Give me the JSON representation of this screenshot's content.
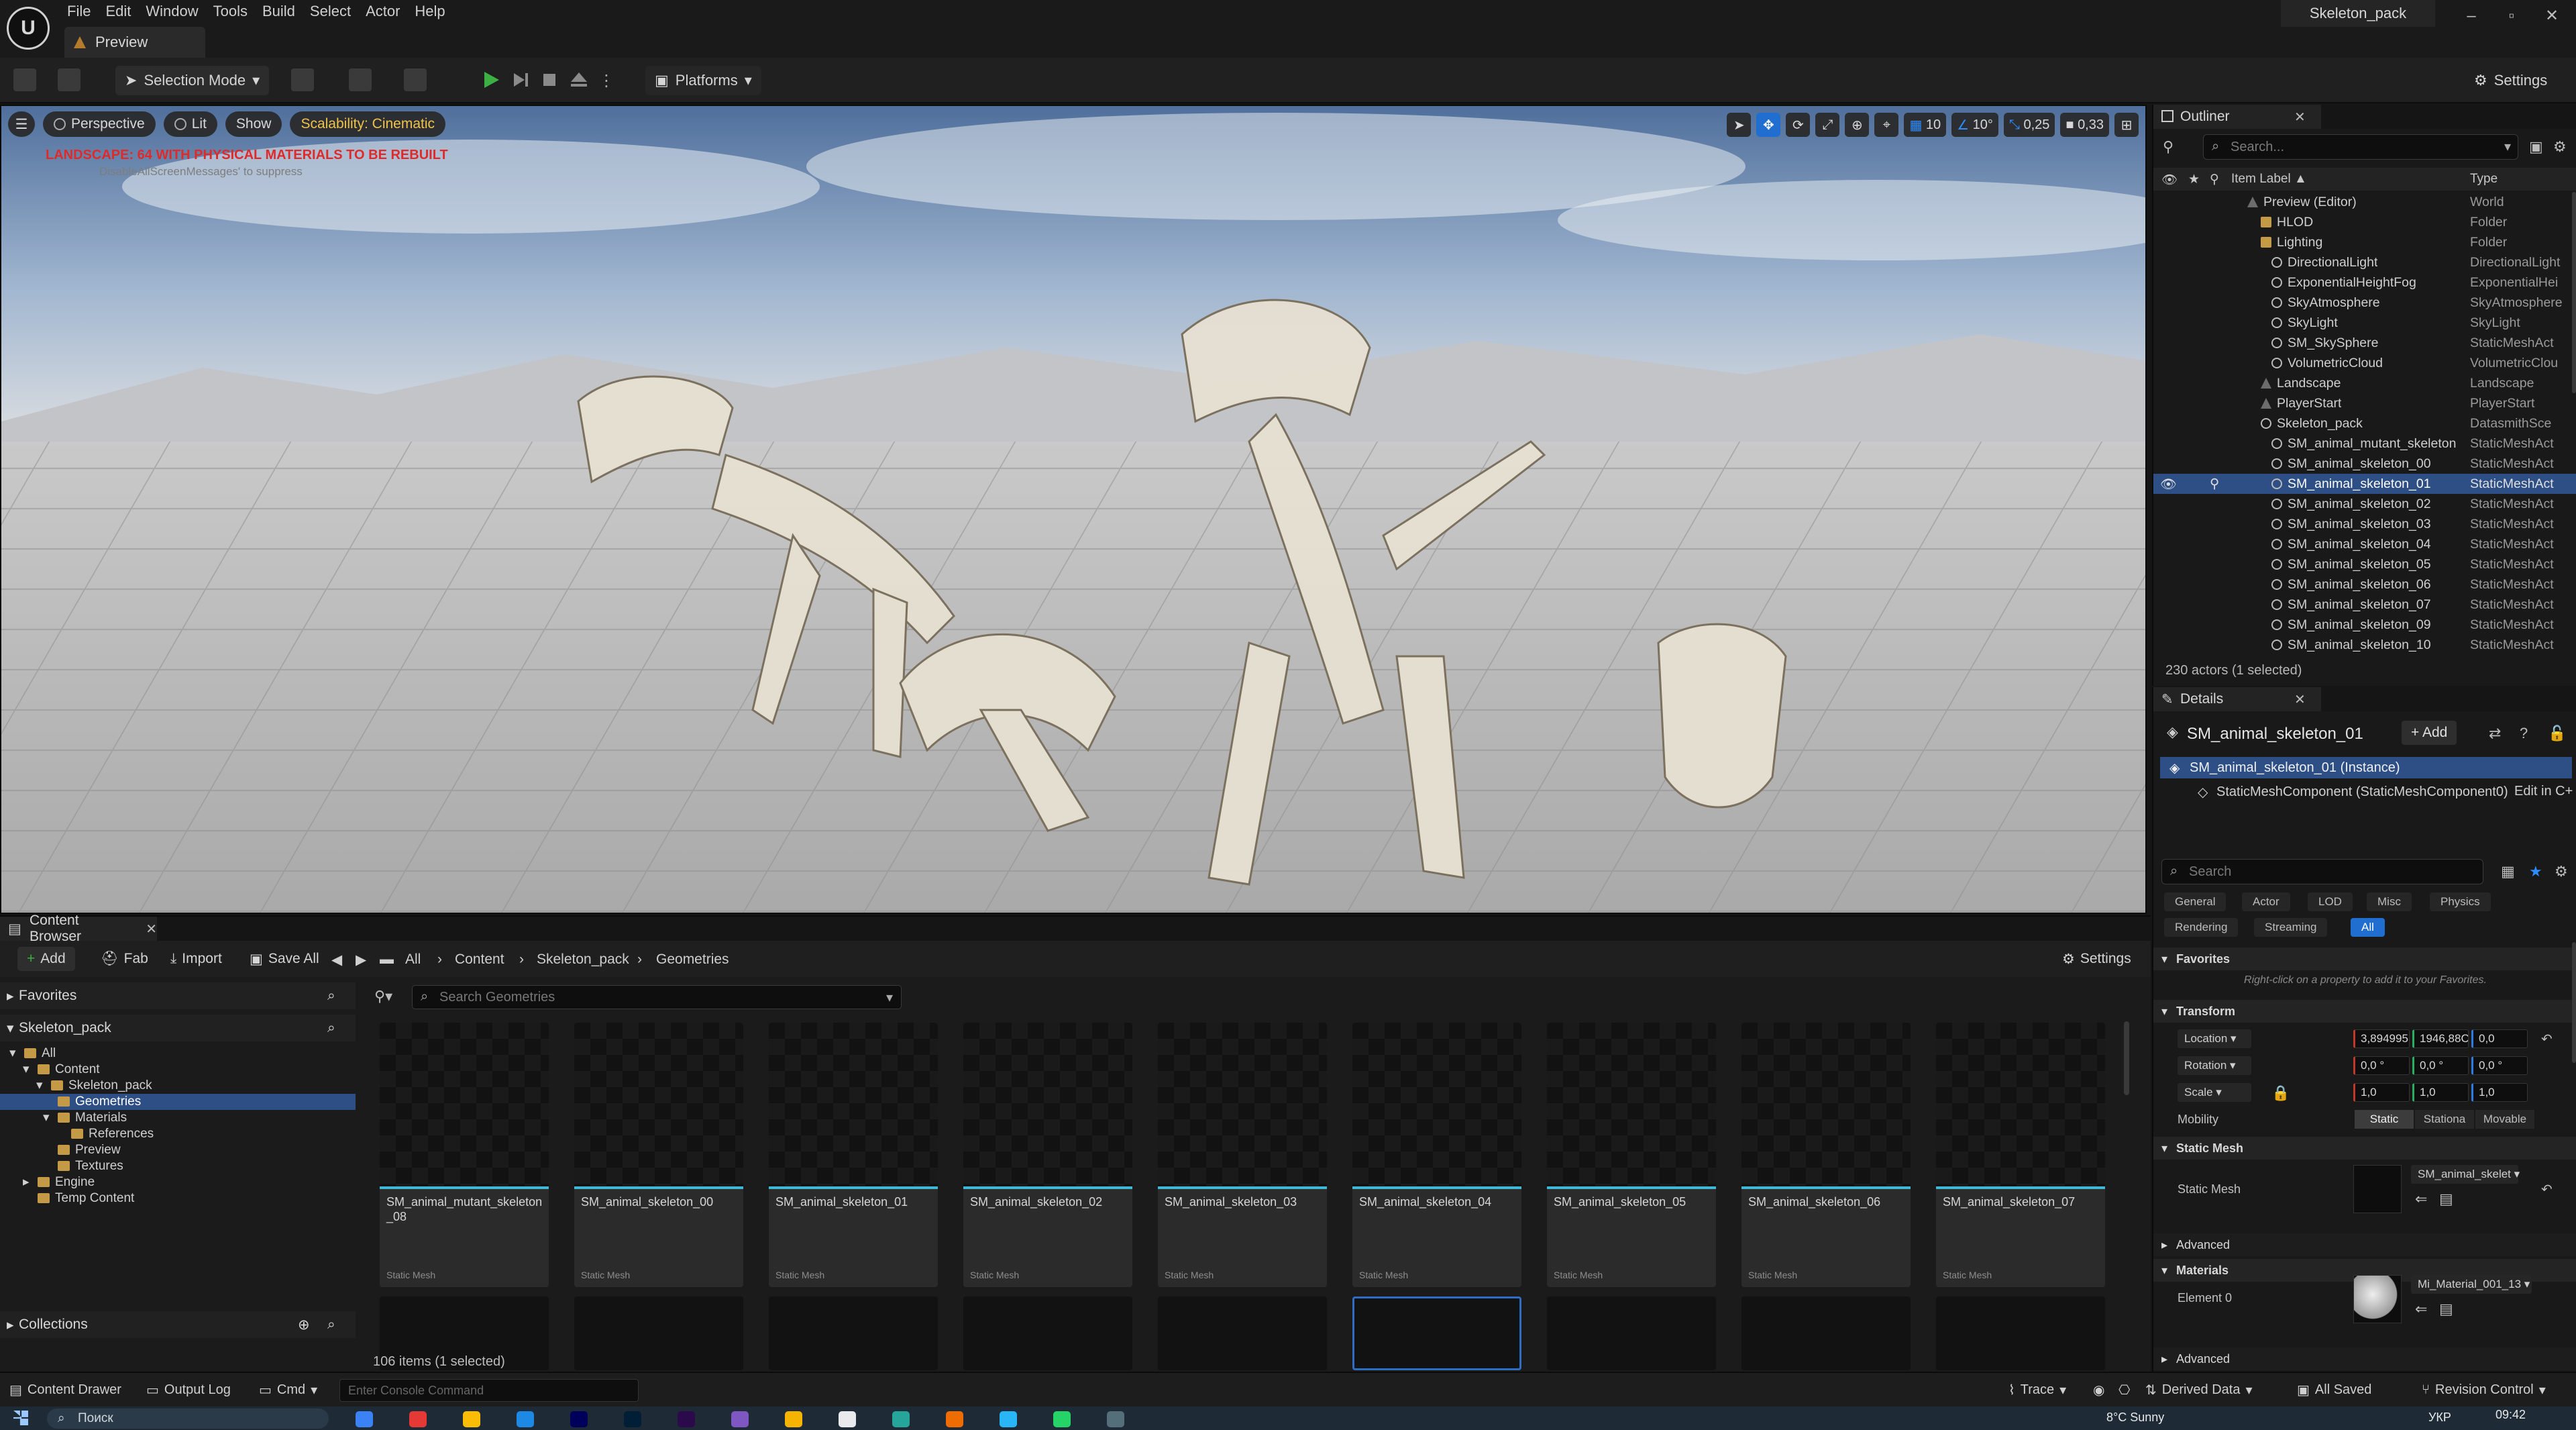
{
  "app": {
    "menu": [
      "File",
      "Edit",
      "Window",
      "Tools",
      "Build",
      "Select",
      "Actor",
      "Help"
    ],
    "doc_tab": "Preview",
    "project_name": "Skeleton_pack",
    "window_controls": [
      "–",
      "▫",
      "✕"
    ]
  },
  "toolbar": {
    "selection_mode": "Selection Mode",
    "platforms": "Platforms",
    "settings": "Settings"
  },
  "viewport": {
    "perspective": "Perspective",
    "lit": "Lit",
    "show": "Show",
    "scalability": "Scalability: Cinematic",
    "warning": "LANDSCAPE: 64  WITH PHYSICAL MATERIALS  TO BE REBUILT",
    "warning_sub": "DisableAllScreenMessages' to suppress",
    "grid_snap": "10",
    "rot_snap": "10°",
    "scale_snap": "0,25",
    "cam_speed": "0,33"
  },
  "outliner": {
    "title": "Outliner",
    "search_placeholder": "Search...",
    "col_label": "Item Label ▲",
    "col_type": "Type",
    "rows": [
      {
        "label": "Preview (Editor)",
        "type": "World"
      },
      {
        "label": "HLOD",
        "type": "Folder"
      },
      {
        "label": "Lighting",
        "type": "Folder"
      },
      {
        "label": "DirectionalLight",
        "type": "DirectionalLight"
      },
      {
        "label": "ExponentialHeightFog",
        "type": "ExponentialHei"
      },
      {
        "label": "SkyAtmosphere",
        "type": "SkyAtmosphere"
      },
      {
        "label": "SkyLight",
        "type": "SkyLight"
      },
      {
        "label": "SM_SkySphere",
        "type": "StaticMeshAct"
      },
      {
        "label": "VolumetricCloud",
        "type": "VolumetricClou"
      },
      {
        "label": "Landscape",
        "type": "Landscape"
      },
      {
        "label": "PlayerStart",
        "type": "PlayerStart"
      },
      {
        "label": "Skeleton_pack",
        "type": "DatasmithSce"
      },
      {
        "label": "SM_animal_mutant_skeleton",
        "type": "StaticMeshAct"
      },
      {
        "label": "SM_animal_skeleton_00",
        "type": "StaticMeshAct"
      },
      {
        "label": "SM_animal_skeleton_01",
        "type": "StaticMeshAct"
      },
      {
        "label": "SM_animal_skeleton_02",
        "type": "StaticMeshAct"
      },
      {
        "label": "SM_animal_skeleton_03",
        "type": "StaticMeshAct"
      },
      {
        "label": "SM_animal_skeleton_04",
        "type": "StaticMeshAct"
      },
      {
        "label": "SM_animal_skeleton_05",
        "type": "StaticMeshAct"
      },
      {
        "label": "SM_animal_skeleton_06",
        "type": "StaticMeshAct"
      },
      {
        "label": "SM_animal_skeleton_07",
        "type": "StaticMeshAct"
      },
      {
        "label": "SM_animal_skeleton_09",
        "type": "StaticMeshAct"
      },
      {
        "label": "SM_animal_skeleton_10",
        "type": "StaticMeshAct"
      }
    ],
    "status": "230 actors (1 selected)"
  },
  "details": {
    "title": "Details",
    "object_name": "SM_animal_skeleton_01",
    "add_label": "+ Add",
    "instance": "SM_animal_skeleton_01 (Instance)",
    "component": "StaticMeshComponent (StaticMeshComponent0)",
    "edit_in": "Edit in C+",
    "search_placeholder": "Search",
    "filters_row1": [
      "General",
      "Actor",
      "LOD",
      "Misc",
      "Physics"
    ],
    "filters_row2": [
      "Rendering",
      "Streaming",
      "All"
    ],
    "favorites": "Favorites",
    "favorites_hint": "Right-click on a property to add it to your Favorites.",
    "transform": "Transform",
    "location": "Location",
    "rotation": "Rotation",
    "scale": "Scale",
    "location_values": [
      "3,894995",
      "1946,88C",
      "0,0"
    ],
    "rotation_values": [
      "0,0 °",
      "0,0 °",
      "0,0 °"
    ],
    "scale_values": [
      "1,0",
      "1,0",
      "1,0"
    ],
    "mobility": "Mobility",
    "mobility_options": [
      "Static",
      "Stationa",
      "Movable"
    ],
    "static_mesh_section": "Static Mesh",
    "static_mesh_label": "Static Mesh",
    "static_mesh_value": "SM_animal_skelet",
    "advanced": "Advanced",
    "materials": "Materials",
    "element0": "Element 0",
    "material_value": "Mi_Material_001_13"
  },
  "content_browser": {
    "tab": "Content Browser",
    "add": "Add",
    "fab": "Fab",
    "import": "Import",
    "save_all": "Save All",
    "breadcrumbs": [
      "All",
      "Content",
      "Skeleton_pack",
      "Geometries"
    ],
    "settings": "Settings",
    "favorites": "Favorites",
    "project": "Skeleton_pack",
    "tree": [
      "All",
      "Content",
      "Skeleton_pack",
      "Geometries",
      "Materials",
      "References",
      "Preview",
      "Textures",
      "Engine",
      "Temp Content"
    ],
    "collections": "Collections",
    "search_placeholder": "Search Geometries",
    "assets": [
      {
        "name": "SM_animal_mutant_skeleton_08",
        "kind": "Static Mesh"
      },
      {
        "name": "SM_animal_skeleton_00",
        "kind": "Static Mesh"
      },
      {
        "name": "SM_animal_skeleton_01",
        "kind": "Static Mesh"
      },
      {
        "name": "SM_animal_skeleton_02",
        "kind": "Static Mesh"
      },
      {
        "name": "SM_animal_skeleton_03",
        "kind": "Static Mesh"
      },
      {
        "name": "SM_animal_skeleton_04",
        "kind": "Static Mesh"
      },
      {
        "name": "SM_animal_skeleton_05",
        "kind": "Static Mesh"
      },
      {
        "name": "SM_animal_skeleton_06",
        "kind": "Static Mesh"
      },
      {
        "name": "SM_animal_skeleton_07",
        "kind": "Static Mesh"
      }
    ],
    "status": "106 items (1 selected)"
  },
  "statusbar": {
    "content_drawer": "Content Drawer",
    "output_log": "Output Log",
    "cmd": "Cmd",
    "console_placeholder": "Enter Console Command",
    "trace": "Trace",
    "derived_data": "Derived Data",
    "all_saved": "All Saved",
    "revision_control": "Revision Control"
  },
  "taskbar": {
    "search": "Поиск",
    "weather": "8°C  Sunny",
    "lang": "УКР",
    "clock": "09:42"
  },
  "colors": {
    "accent": "#1f6ed0",
    "selection": "#2d4f86",
    "asset_bar": "#3fb7d6",
    "warning": "#e02a2a",
    "scalability": "#f0c24a",
    "play": "#3cb043"
  }
}
